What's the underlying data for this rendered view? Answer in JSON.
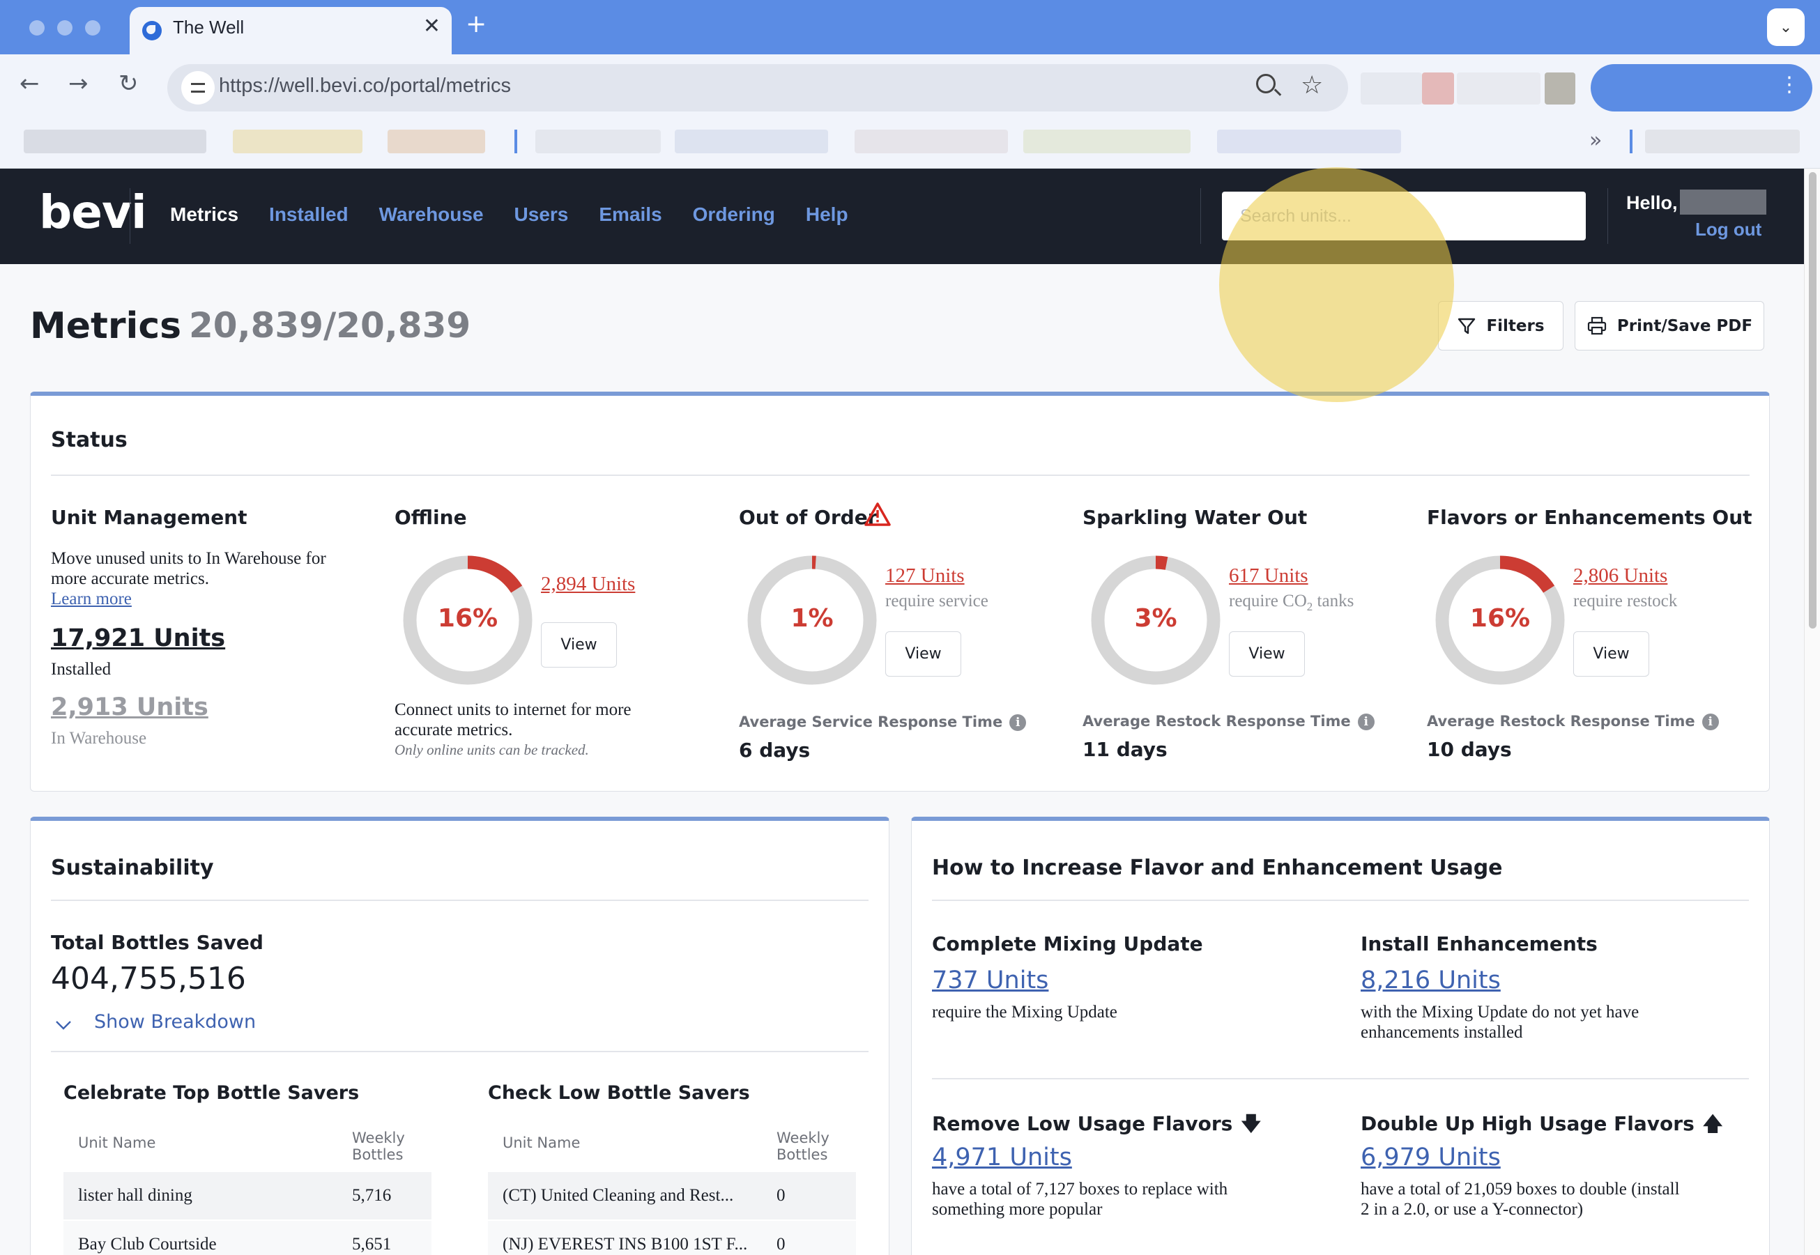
{
  "browser": {
    "tab_title": "The Well",
    "tab_close": "✕",
    "new_tab": "+",
    "url": "https://well.bevi.co/portal/metrics",
    "nav_back": "←",
    "nav_forward": "→",
    "nav_reload": "↻",
    "more_bookmarks": "»"
  },
  "header": {
    "logo": "bevi",
    "nav": [
      "Metrics",
      "Installed",
      "Warehouse",
      "Users",
      "Emails",
      "Ordering",
      "Help"
    ],
    "active_nav": "Metrics",
    "search_placeholder": "Search units...",
    "hello": "Hello,",
    "logout": "Log out"
  },
  "page": {
    "title": "Metrics",
    "unit_count": "20,839/20,839",
    "filters_label": "Filters",
    "print_label": "Print/Save PDF"
  },
  "status": {
    "title": "Status",
    "unit_management": {
      "title": "Unit Management",
      "line1": "Move unused units to In Warehouse for",
      "line2": "more accurate metrics.",
      "learn_more": "Learn more",
      "installed_count": "17,921 Units",
      "installed_label": "Installed",
      "warehouse_count": "2,913 Units",
      "warehouse_label": "In Warehouse"
    },
    "offline": {
      "title": "Offline",
      "percent": "16%",
      "fraction": 0.16,
      "units": "2,894 Units",
      "view": "View",
      "note1": "Connect units to internet for more",
      "note2": "accurate metrics.",
      "italic": "Only online units can be tracked."
    },
    "out_of_order": {
      "title": "Out of Order",
      "percent": "1%",
      "fraction": 0.01,
      "units": "127 Units",
      "sub": "require service",
      "view": "View",
      "avg_label": "Average Service Response Time",
      "avg_value": "6 days"
    },
    "sparkling": {
      "title": "Sparkling Water Out",
      "percent": "3%",
      "fraction": 0.03,
      "units": "617 Units",
      "sub_a": "require CO",
      "sub_sub": "2",
      "sub_b": " tanks",
      "view": "View",
      "avg_label": "Average Restock Response Time",
      "avg_value": "11 days"
    },
    "flavors": {
      "title": "Flavors or Enhancements Out",
      "percent": "16%",
      "fraction": 0.16,
      "units": "2,806 Units",
      "sub": "require restock",
      "view": "View",
      "avg_label": "Average Restock Response Time",
      "avg_value": "10 days"
    }
  },
  "sustainability": {
    "title": "Sustainability",
    "total_label": "Total Bottles Saved",
    "total_value": "404,755,516",
    "breakdown": "Show Breakdown",
    "top_title": "Celebrate Top Bottle Savers",
    "low_title": "Check Low Bottle Savers",
    "col_name": "Unit Name",
    "col_weekly_a": "Weekly",
    "col_weekly_b": "Bottles",
    "top_rows": [
      {
        "name": "lister hall dining",
        "value": "5,716"
      },
      {
        "name": "Bay Club Courtside",
        "value": "5,651"
      }
    ],
    "low_rows": [
      {
        "name": "(CT) United Cleaning and Rest...",
        "value": "0"
      },
      {
        "name": "(NJ) EVEREST INS B100 1ST F...",
        "value": "0"
      }
    ]
  },
  "flavor_usage": {
    "title": "How to Increase Flavor and Enhancement Usage",
    "mixing": {
      "title": "Complete Mixing Update",
      "units": "737 Units",
      "sub": "require the Mixing Update"
    },
    "enhancements": {
      "title": "Install Enhancements",
      "units": "8,216 Units",
      "sub1": "with the Mixing Update do not yet have",
      "sub2": "enhancements installed"
    },
    "low_usage": {
      "title": "Remove Low Usage Flavors",
      "arrow": "🡇",
      "units": "4,971 Units",
      "sub1": "have a total of 7,127 boxes to replace with",
      "sub2": "something more popular"
    },
    "high_usage": {
      "title": "Double Up High Usage Flavors",
      "arrow": "🡅",
      "units": "6,979 Units",
      "sub1": "have a total of 21,059 boxes to double (install",
      "sub2": "2 in a 2.0, or use a Y-connector)"
    }
  },
  "colors": {
    "accent": "#cc3c33",
    "track": "#d6d6d6",
    "link": "#3e62b0",
    "header_bg": "#1b202b"
  }
}
